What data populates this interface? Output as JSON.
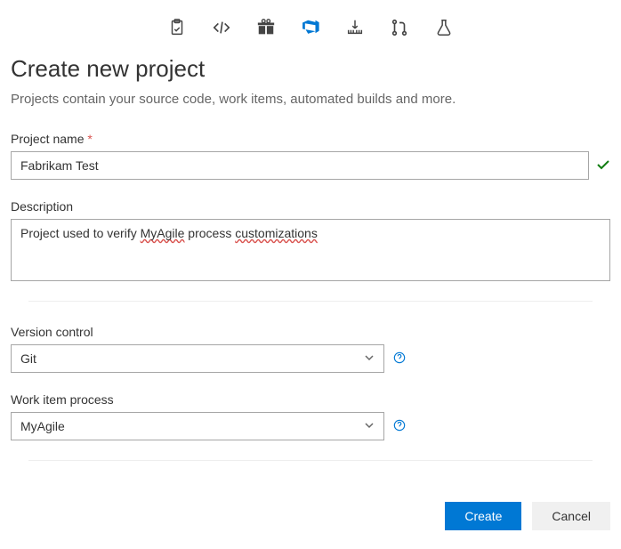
{
  "header": {
    "icons": [
      "clipboard-icon",
      "code-icon",
      "gift-icon",
      "azure-devops-icon",
      "download-icon",
      "pull-request-icon",
      "flask-icon"
    ],
    "active_index": 3
  },
  "page": {
    "title": "Create new project",
    "subtitle": "Projects contain your source code, work items, automated builds and more."
  },
  "fields": {
    "project_name": {
      "label": "Project name",
      "required_mark": "*",
      "value": "Fabrikam Test",
      "valid": true
    },
    "description": {
      "label": "Description",
      "value_prefix": "Project used to verify ",
      "value_word1": "MyAgile",
      "value_mid": " process ",
      "value_word2": "customizations"
    },
    "version_control": {
      "label": "Version control",
      "value": "Git"
    },
    "work_item_process": {
      "label": "Work item process",
      "value": "MyAgile"
    }
  },
  "buttons": {
    "create": "Create",
    "cancel": "Cancel"
  }
}
